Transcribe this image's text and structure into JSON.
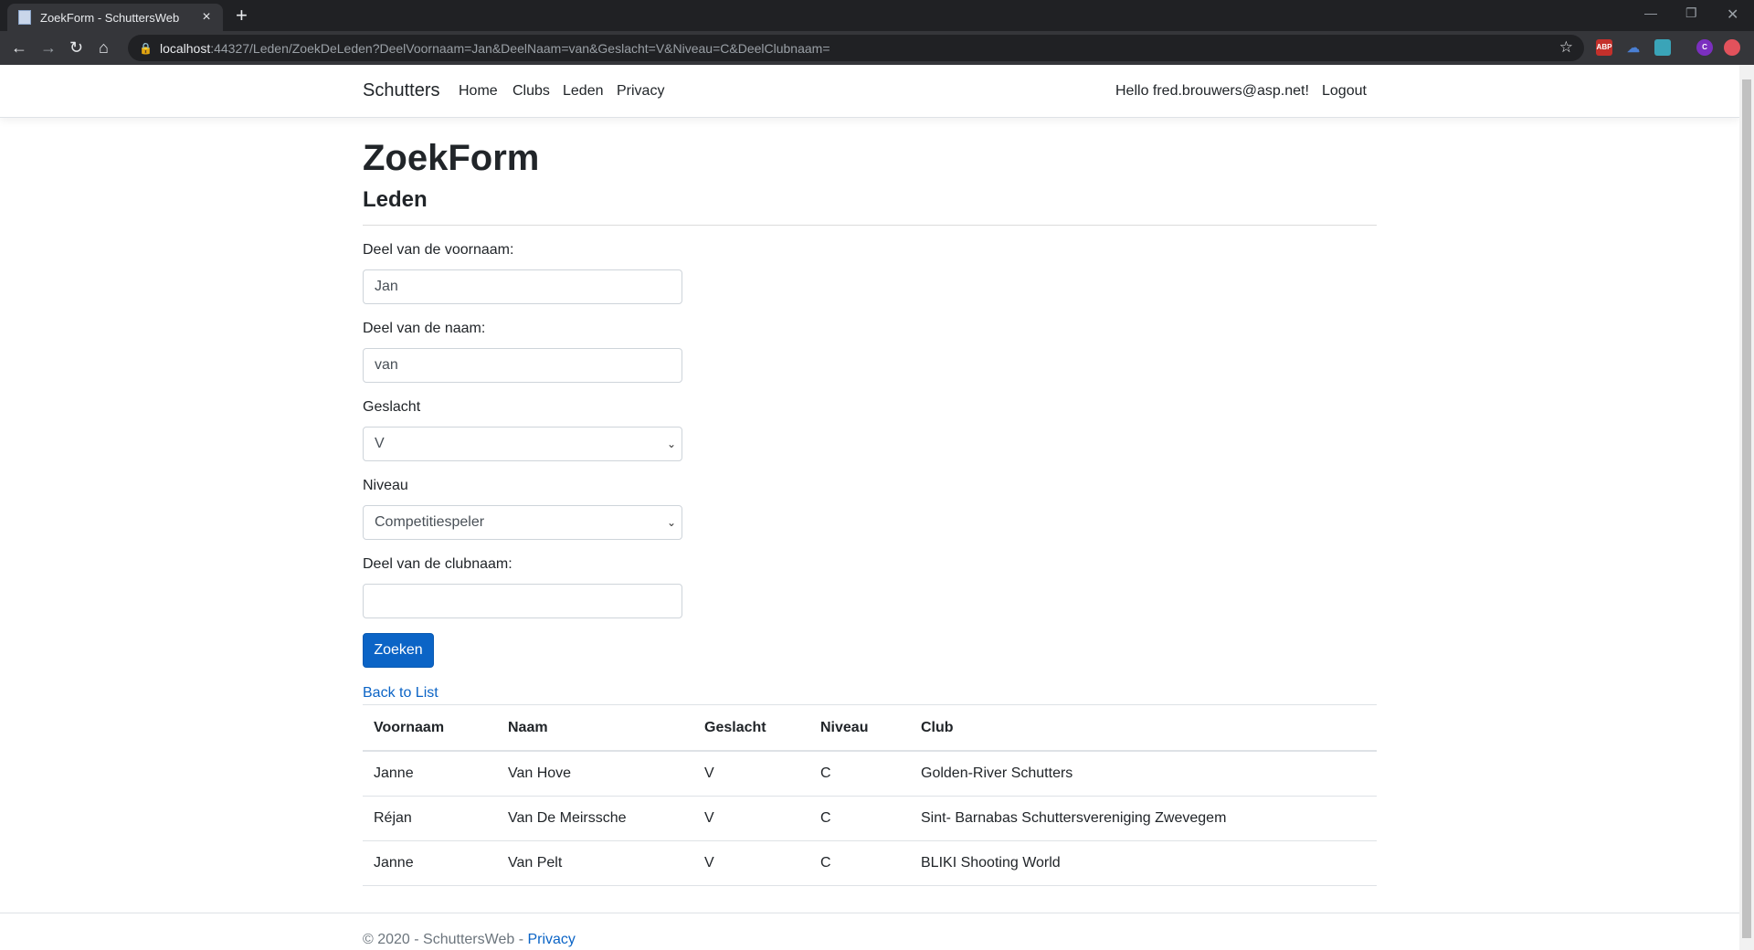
{
  "browser": {
    "tab_title": "ZoekForm - SchuttersWeb",
    "tab_close": "×",
    "new_tab": "+",
    "url_host": "localhost",
    "url_rest": ":44327/Leden/ZoekDeLeden?DeelVoornaam=Jan&DeelNaam=van&Geslacht=V&Niveau=C&DeelClubnaam=",
    "ext_abp": "ABP",
    "ext_profile": "C"
  },
  "nav": {
    "brand": "Schutters",
    "links": [
      "Home",
      "Clubs",
      "Leden",
      "Privacy"
    ],
    "hello": "Hello fred.brouwers@asp.net!",
    "logout": "Logout"
  },
  "page": {
    "title": "ZoekForm",
    "subtitle": "Leden"
  },
  "form": {
    "voornaam_label": "Deel van de voornaam:",
    "voornaam_value": "Jan",
    "naam_label": "Deel van de naam:",
    "naam_value": "van",
    "geslacht_label": "Geslacht",
    "geslacht_value": "V",
    "niveau_label": "Niveau",
    "niveau_value": "Competitiespeler",
    "club_label": "Deel van de clubnaam:",
    "club_value": "",
    "submit": "Zoeken",
    "back": "Back to List"
  },
  "table": {
    "headers": [
      "Voornaam",
      "Naam",
      "Geslacht",
      "Niveau",
      "Club"
    ],
    "rows": [
      [
        "Janne",
        "Van Hove",
        "V",
        "C",
        "Golden-River Schutters"
      ],
      [
        "Réjan",
        "Van De Meirssche",
        "V",
        "C",
        "Sint- Barnabas Schuttersvereniging Zwevegem"
      ],
      [
        "Janne",
        "Van Pelt",
        "V",
        "C",
        "BLIKI Shooting World"
      ]
    ]
  },
  "footer": {
    "text": "© 2020 - SchuttersWeb - ",
    "privacy": "Privacy"
  },
  "colors": {
    "primary": "#0b64c6",
    "chrome_dark": "#202124",
    "chrome_tab": "#35363a"
  }
}
